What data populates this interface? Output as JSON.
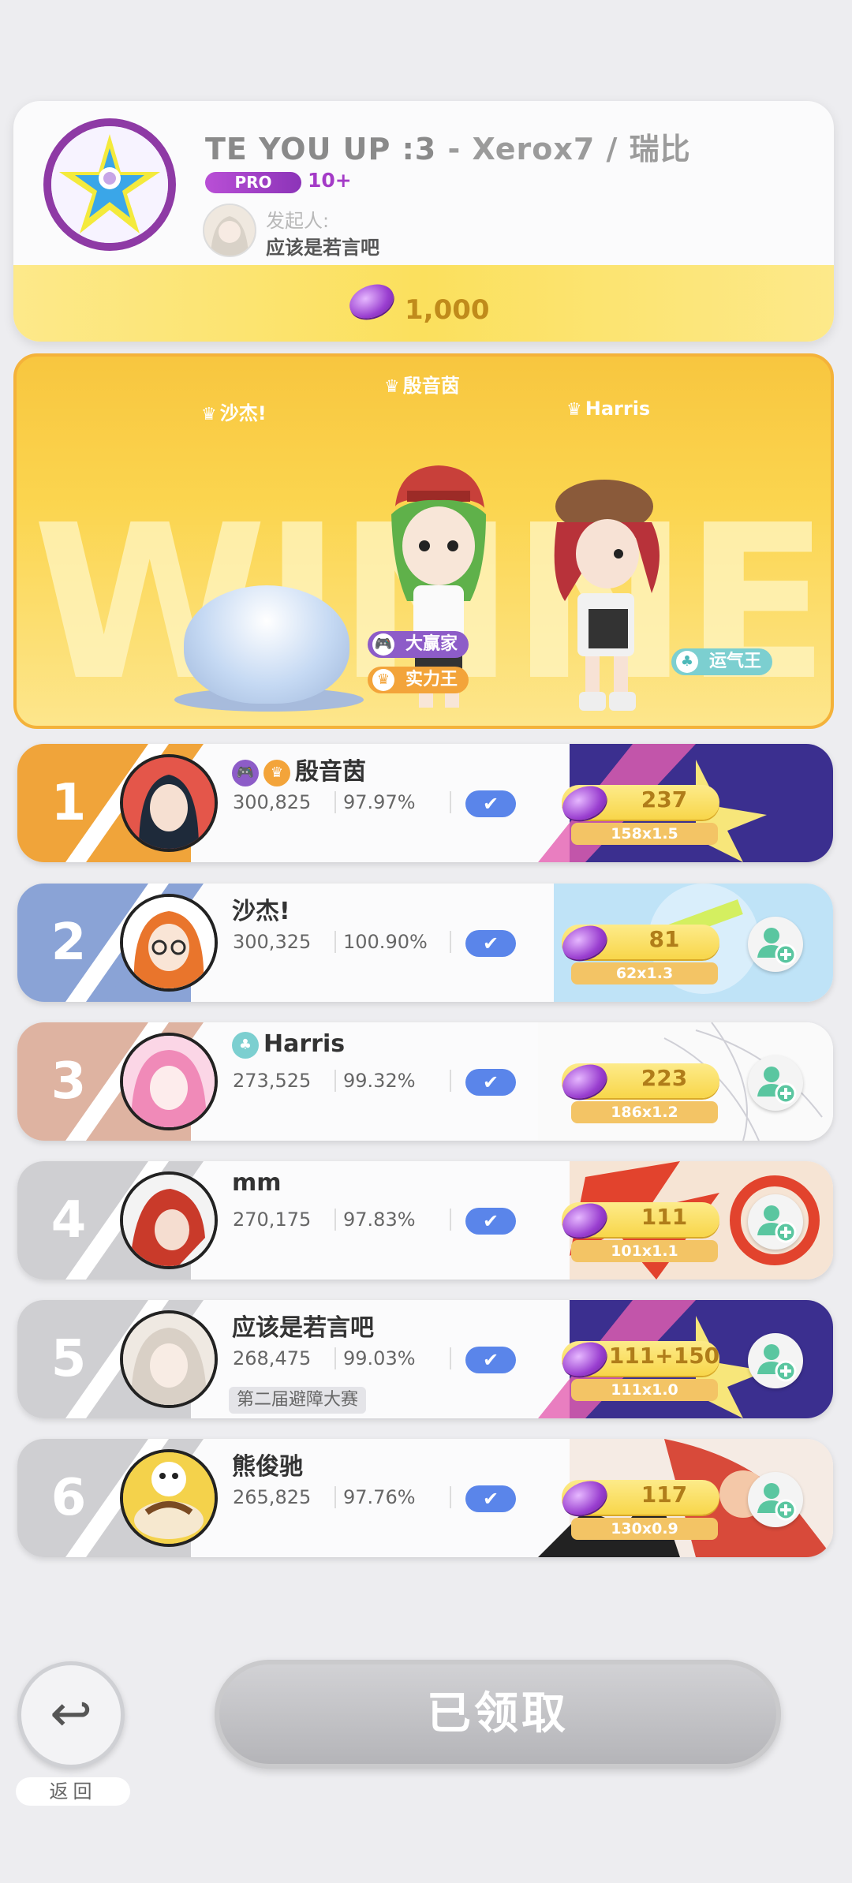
{
  "header": {
    "song_title": "TE YOU UP :3",
    "song_artist": " - Xerox7 / 瑞比",
    "difficulty": "PRO",
    "level": "10+",
    "host_label": "发起人:",
    "host_name": "应该是若言吧",
    "reward_amount": "1,000"
  },
  "winner_panel": {
    "background_word": "WINNER",
    "top_players": [
      {
        "name": "沙杰!"
      },
      {
        "name": "殷音茵"
      },
      {
        "name": "Harris"
      }
    ],
    "tags": {
      "big_winner": "大赢家",
      "strength_king": "实力王",
      "luck_king": "运气王"
    }
  },
  "ranking": [
    {
      "rank": "1",
      "name": "殷音茵",
      "score": "300,825",
      "accuracy": "97.97%",
      "reward": "237",
      "multiplier": "158x1.5",
      "color": "#f0a43a"
    },
    {
      "rank": "2",
      "name": "沙杰!",
      "score": "300,325",
      "accuracy": "100.90%",
      "reward": "81",
      "multiplier": "62x1.3",
      "color": "#8aa3d6"
    },
    {
      "rank": "3",
      "name": "Harris",
      "score": "273,525",
      "accuracy": "99.32%",
      "reward": "223",
      "multiplier": "186x1.2",
      "color": "#deb3a1"
    },
    {
      "rank": "4",
      "name": "mm",
      "score": "270,175",
      "accuracy": "97.83%",
      "reward": "111",
      "multiplier": "101x1.1",
      "color": "#cfcfd2"
    },
    {
      "rank": "5",
      "name": "应该是若言吧",
      "score": "268,475",
      "accuracy": "99.03%",
      "reward": "111+150",
      "multiplier": "111x1.0",
      "color": "#cfcfd2",
      "tag": "第二届避障大赛"
    },
    {
      "rank": "6",
      "name": "熊俊驰",
      "score": "265,825",
      "accuracy": "97.76%",
      "reward": "117",
      "multiplier": "130x0.9",
      "color": "#cfcfd2"
    }
  ],
  "footer": {
    "back_label": "返回",
    "claimed_label": "已领取"
  }
}
